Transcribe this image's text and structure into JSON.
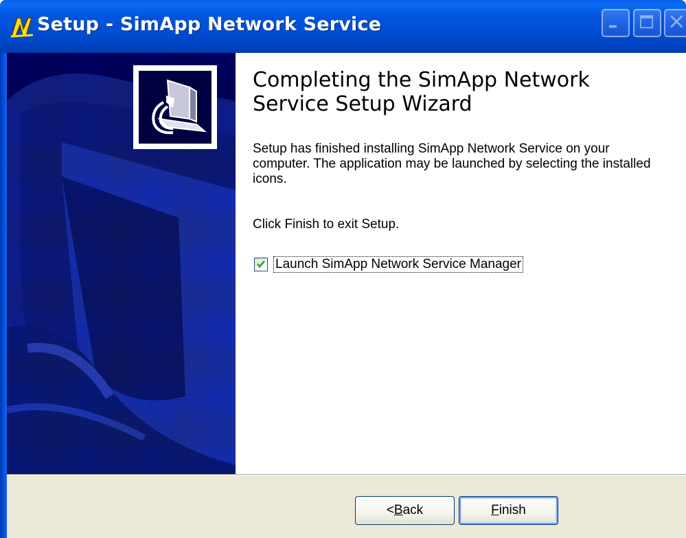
{
  "window": {
    "title": "Setup - SimApp Network Service",
    "colors": {
      "titlebar": "#0055e5",
      "banner": "#000060",
      "buttonbar": "#ece9d8"
    }
  },
  "titlebar_buttons": [
    {
      "name": "minimize",
      "icon": "minimize-icon"
    },
    {
      "name": "maximize",
      "icon": "maximize-icon"
    },
    {
      "name": "close",
      "icon": "close-icon"
    }
  ],
  "content": {
    "heading_line1": "Completing the SimApp Network",
    "heading_line2": "Service Setup Wizard",
    "paragraph": "Setup has finished installing SimApp Network Service on your computer. The application may be launched by selecting the installed icons.",
    "exit_hint": "Click Finish to exit Setup.",
    "launch_checkbox": {
      "label": "Launch SimApp Network Service Manager",
      "checked": true
    }
  },
  "buttons": {
    "back": {
      "prefix": "< ",
      "mnemonic": "B",
      "rest": "ack"
    },
    "finish": {
      "mnemonic": "F",
      "rest": "inish"
    }
  }
}
